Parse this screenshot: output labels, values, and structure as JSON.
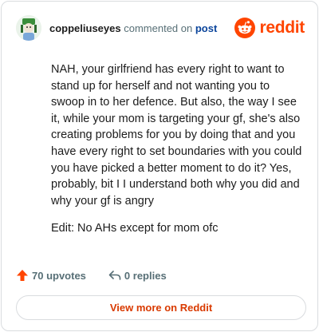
{
  "comment": {
    "username": "coppeliuseyes",
    "action": "commented on",
    "post_link": "post",
    "paragraphs": [
      "NAH, your girlfriend has every right to want to stand up for herself and not wanting you to swoop in to her defence. But also, the way I see it, while your mom is targeting your gf, she's also creating problems for you by doing that and you have every right to set boundaries with you could you have picked a better moment to do it? Yes, probably, bit I I understand both why you did and why your gf is angry",
      "Edit: No AHs except for mom ofc"
    ]
  },
  "brand": {
    "name": "reddit",
    "color": "#ff4500",
    "icon": "reddit-snoo-icon"
  },
  "actions": {
    "upvotes": "70 upvotes",
    "replies": "0 replies",
    "upvote_icon": "upvote-arrow-icon",
    "reply_icon": "reply-arrow-icon",
    "upvote_color": "#ff4500"
  },
  "view_more_label": "View more on Reddit",
  "view_more_color": "#d93a00"
}
